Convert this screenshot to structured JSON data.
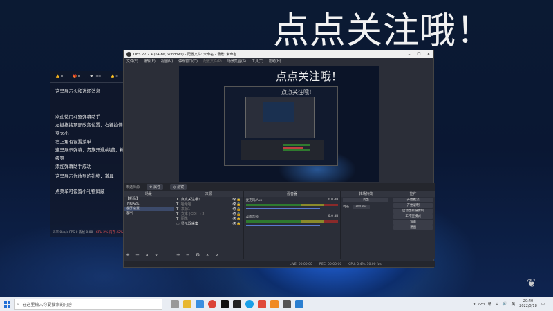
{
  "overlay_title": "点点关注哦！",
  "chat": {
    "stats": [
      "0",
      "0",
      "100",
      "0"
    ],
    "messages": [
      "这里展示火和进场消息",
      "欢迎使用斗鱼弹幕助手",
      "左键拖拽顶部改变位置，右键拉伸改框",
      "变大小",
      "右上角有设置菜单",
      "这里展示弹幕，贵族开通/续费，粉丝牌升",
      "级等",
      "添加弹幕助手成功",
      "这里展示你收到的礼物，道具",
      "点菜单可设置小礼物屏蔽"
    ],
    "footer": "码率 0kb/s  FPS 0  丢帧 0.00",
    "cpu": "CPU 2%  内存 42%"
  },
  "obs": {
    "title": "OBS 27.2.4 (64-bit, windows) - 配置文件: 未命名 - 场景: 未命名",
    "menu": [
      "文件(F)",
      "编辑(E)",
      "视图(V)",
      "停靠窗口(D)",
      "配置文件(P)",
      "场景集合(S)",
      "工具(T)",
      "帮助(H)"
    ],
    "preview_text": "点点关注哦！",
    "nested_text": "点点关注哦！",
    "scene_bar": {
      "label": "未选择源",
      "props": "属性",
      "filters": "滤镜"
    },
    "scenes": {
      "header": "场景",
      "items": [
        "【新场】",
        "[NOA2K]",
        "退屏设置",
        "退出"
      ],
      "selected": 2
    },
    "sources": {
      "header": "来源",
      "items": [
        {
          "icon": "T",
          "label": "点点关注哦！"
        },
        {
          "icon": "T",
          "label": "哈哈哈"
        },
        {
          "icon": "T",
          "label": "来源1"
        },
        {
          "icon": "T",
          "label": "文本 (GDI+) 2"
        },
        {
          "icon": "T",
          "label": "图像"
        },
        {
          "icon": "▭",
          "label": "显示器采集"
        }
      ]
    },
    "mixer": {
      "header": "混音器",
      "channels": [
        {
          "name": "麦克风/Aux",
          "db": "0.0 dB"
        },
        {
          "name": "桌面音频",
          "db": "0.0 dB"
        }
      ]
    },
    "transitions": {
      "header": "转场特效",
      "type": "淡出",
      "duration_label": "时长",
      "duration": "300 ms"
    },
    "controls": {
      "header": "控件",
      "buttons": [
        "开始推流",
        "开始录制",
        "启动虚拟摄像机",
        "工作室模式",
        "设置",
        "退出"
      ]
    },
    "status": [
      "LIVE: 00:00:00",
      "REC: 00:00:00",
      "CPU: 0.4%, 30.00 fps"
    ]
  },
  "taskbar": {
    "search_placeholder": "在这里输入你要搜索的内容",
    "weather": "22°C 晴",
    "lang": "英",
    "time": "20:40",
    "date": "2022/5/18"
  }
}
